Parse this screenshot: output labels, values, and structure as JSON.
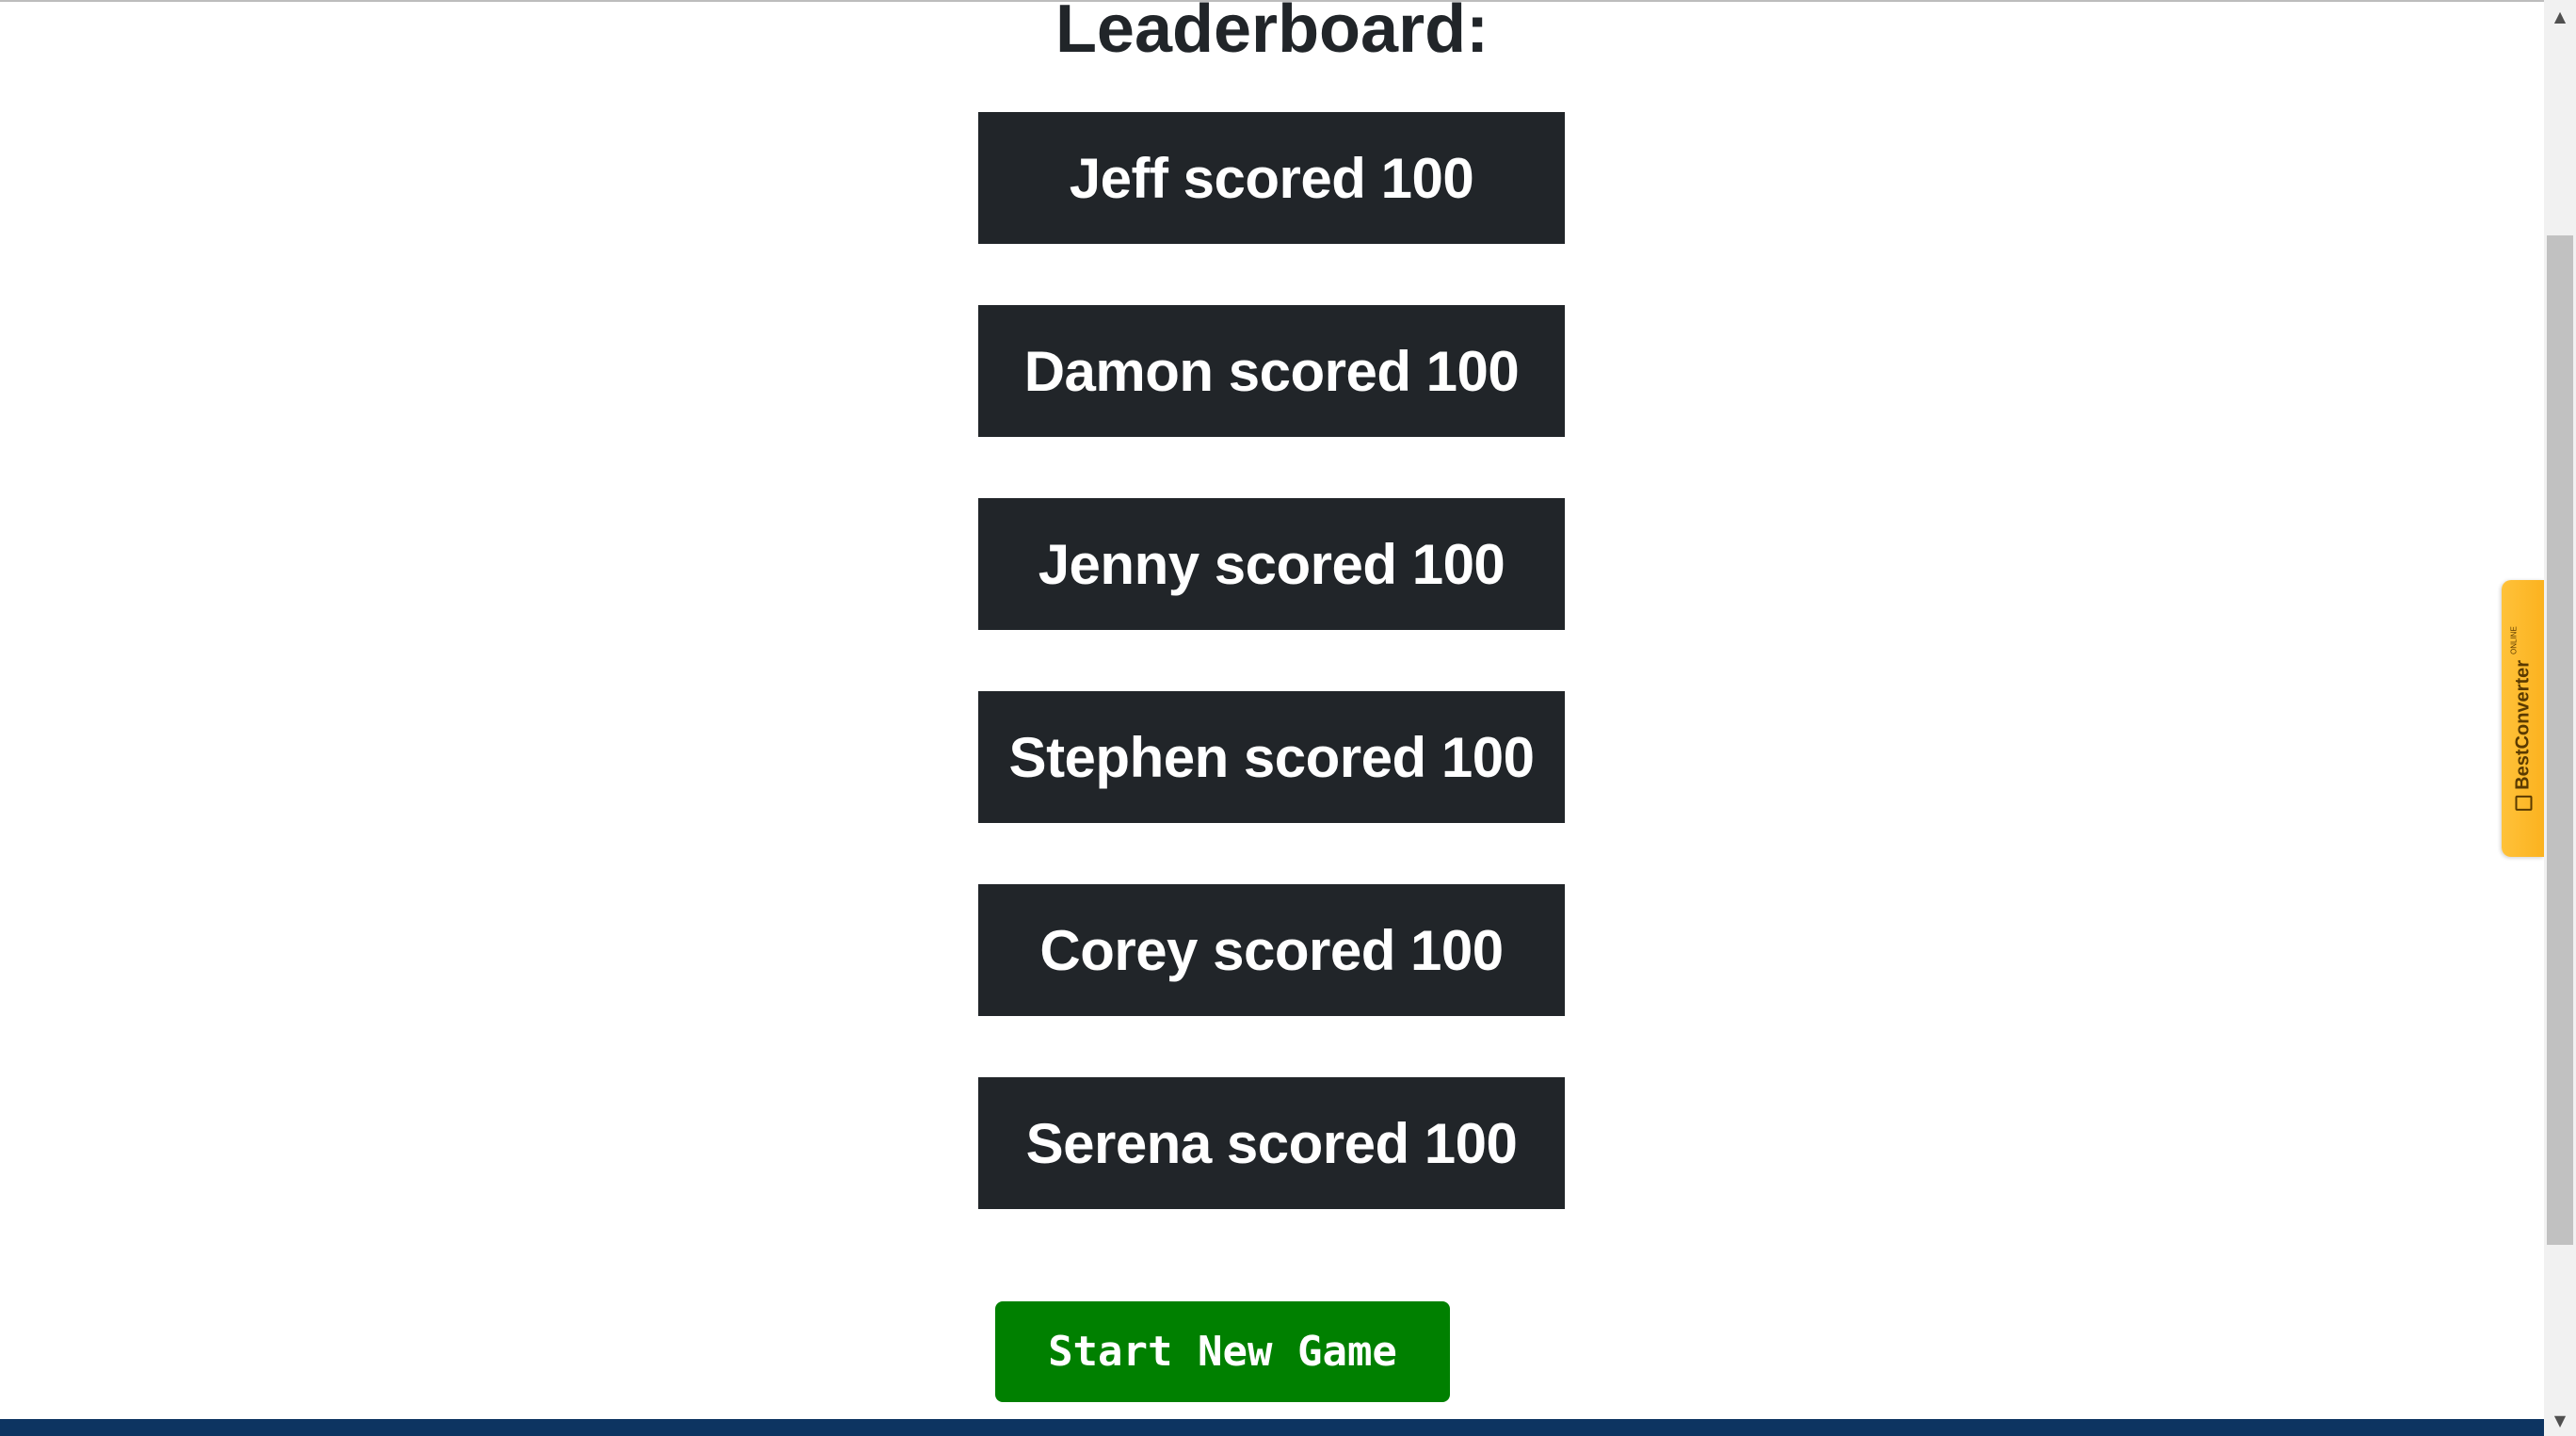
{
  "leaderboard": {
    "title": "Leaderboard:",
    "entries": [
      {
        "text": "Jeff scored 100"
      },
      {
        "text": "Damon scored 100"
      },
      {
        "text": "Jenny scored 100"
      },
      {
        "text": "Stephen scored 100"
      },
      {
        "text": "Corey scored 100"
      },
      {
        "text": "Serena scored 100"
      }
    ]
  },
  "actions": {
    "start_new_game_label": "Start New Game"
  },
  "extension": {
    "label": "BestConverter",
    "sublabel": "ONLINE",
    "icon": "document-icon"
  },
  "scrollbar": {
    "up_icon": "▲",
    "down_icon": "▼"
  },
  "colors": {
    "entry_background": "#212529",
    "button_background": "#008000",
    "footer": "#0d3461",
    "extension_tab": "#fbb21f"
  }
}
